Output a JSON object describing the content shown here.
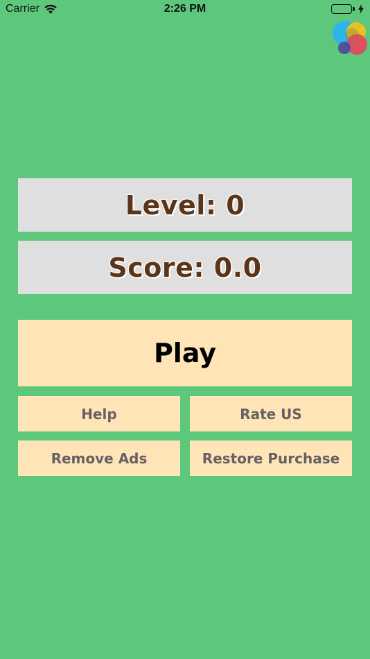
{
  "status_bar": {
    "carrier": "Carrier",
    "time": "2:26 PM",
    "wifi_icon": "wifi-icon",
    "battery_icon": "battery-icon",
    "charging_icon": "bolt-icon"
  },
  "corner_logo": {
    "icon": "game-center-icon",
    "colors": [
      "#2ab4f0",
      "#f5c21a",
      "#e8455f",
      "#4a4fa0"
    ]
  },
  "level": {
    "text": "Level: 0"
  },
  "score": {
    "text": "Score: 0.0"
  },
  "buttons": {
    "play": "Play",
    "help": "Help",
    "rate": "Rate US",
    "remove_ads": "Remove Ads",
    "restore_purchase": "Restore Purchase"
  },
  "colors": {
    "background": "#5dc77c",
    "panel": "#e0dfe0",
    "button": "#fee4b7",
    "title_text": "#5b3519",
    "button_text": "#666162"
  }
}
